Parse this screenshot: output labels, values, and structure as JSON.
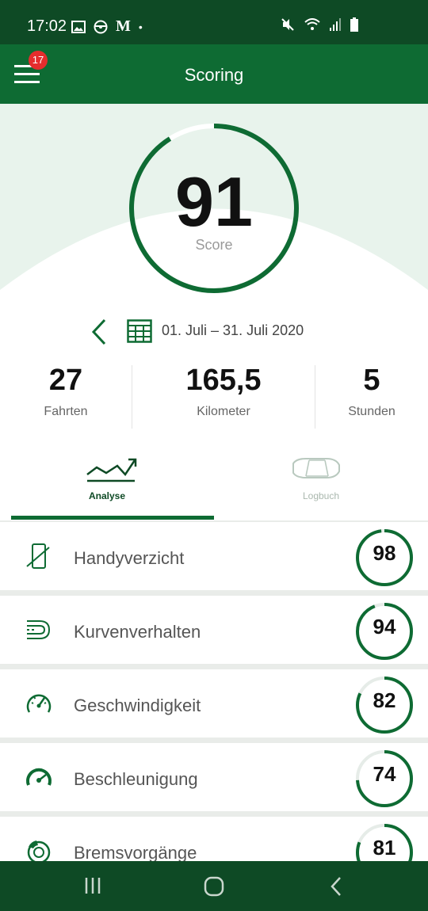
{
  "status_bar": {
    "time": "17:02",
    "left_icons": [
      "image-icon",
      "steering-wheel-icon",
      "gmail-icon",
      "dot-icon"
    ],
    "right_icons": [
      "mute-vibrate-icon",
      "wifi-icon",
      "signal-icon",
      "battery-icon"
    ],
    "letter_m": "M",
    "dot": "•"
  },
  "app_bar": {
    "title": "Scoring",
    "notification_count": "17"
  },
  "score": {
    "value": "91",
    "label": "Score",
    "fraction": 0.91,
    "ring_color": "#0e6b33"
  },
  "period": {
    "text": "01. Juli – 31. Juli 2020"
  },
  "stats": [
    {
      "value": "27",
      "label": "Fahrten"
    },
    {
      "value": "165,5",
      "label": "Kilometer"
    },
    {
      "value": "5",
      "label": "Stunden"
    }
  ],
  "tabs": [
    {
      "label": "Analyse",
      "active": true,
      "icon": "trend-chart-icon"
    },
    {
      "label": "Logbuch",
      "active": false,
      "icon": "car-icon"
    }
  ],
  "categories": [
    {
      "label": "Handyverzicht",
      "score": "98",
      "fraction": 0.98,
      "icon": "phone-off-icon"
    },
    {
      "label": "Kurvenverhalten",
      "score": "94",
      "fraction": 0.94,
      "icon": "curve-icon"
    },
    {
      "label": "Geschwindigkeit",
      "score": "82",
      "fraction": 0.82,
      "icon": "speedometer-icon"
    },
    {
      "label": "Beschleunigung",
      "score": "74",
      "fraction": 0.74,
      "icon": "acceleration-gauge-icon"
    },
    {
      "label": "Bremsvorgänge",
      "score": "81",
      "fraction": 0.81,
      "icon": "brake-disc-icon"
    }
  ],
  "colors": {
    "status_bar": "#0e4a25",
    "app_bar": "#0e6b33",
    "accent": "#0e6b33",
    "badge": "#e52d2d"
  },
  "nav_bar": {
    "buttons": [
      "recents-icon",
      "home-icon",
      "back-icon"
    ]
  }
}
